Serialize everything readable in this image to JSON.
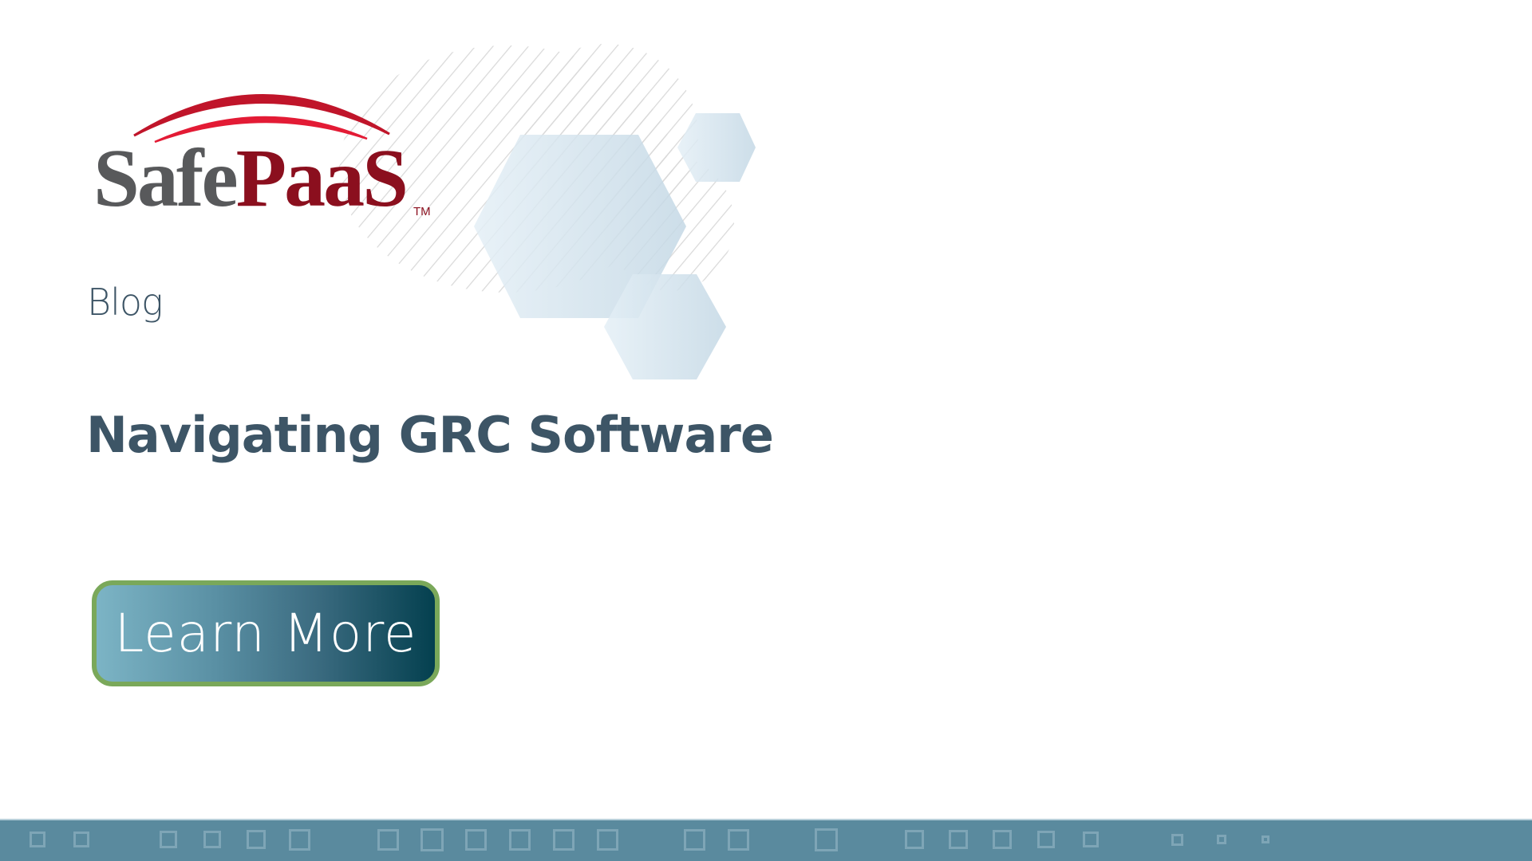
{
  "brand": {
    "name_part1": "Safe",
    "name_part2": "PaaS",
    "trademark": "TM",
    "colors": {
      "gray": "#58595b",
      "red_dark": "#8b0f1e",
      "arc_outer": "#c0152a",
      "arc_inner": "#e31b35"
    }
  },
  "category_label": "Blog",
  "title": "Navigating GRC Software",
  "cta": {
    "label": "Learn More",
    "colors": {
      "border": "#7aa85a",
      "gradient_start": "#7cb4c5",
      "gradient_end": "#04404f"
    }
  },
  "theme": {
    "text_color": "#3d5566",
    "footer_band": "#5a8a9e",
    "hexagon_tint": "#cfe1ec"
  },
  "footer_pattern": {
    "icon": "square-outline-icon",
    "count": 23
  }
}
